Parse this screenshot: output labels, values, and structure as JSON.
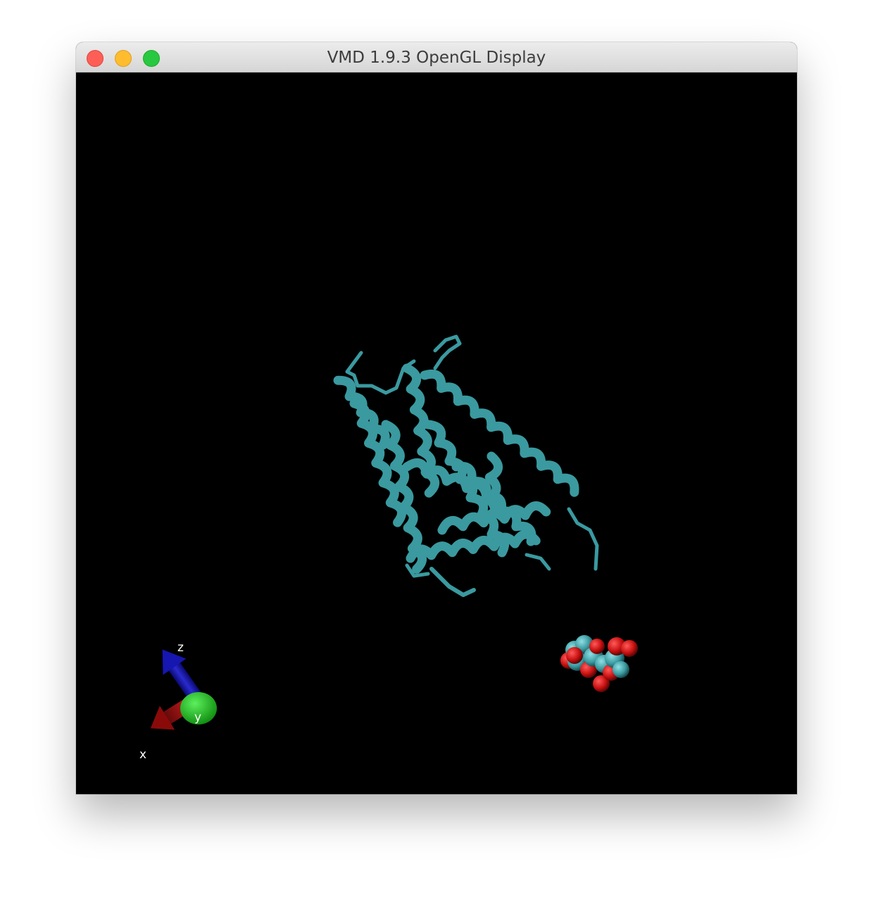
{
  "window": {
    "title": "VMD 1.9.3 OpenGL Display",
    "buttons": [
      "close",
      "minimize",
      "zoom"
    ]
  },
  "display": {
    "background": "#000000",
    "protein": {
      "representation": "NewCartoon",
      "color": "#3a9aa0"
    },
    "ligand": {
      "representation": "VDW",
      "atom_colors": {
        "carbon": "#3fa5ac",
        "oxygen": "#cc1111"
      }
    },
    "axes": {
      "x_label": "x",
      "y_label": "y",
      "z_label": "z",
      "x_color": "#b01010",
      "y_color": "#1fb31f",
      "z_color": "#1010a0"
    }
  }
}
